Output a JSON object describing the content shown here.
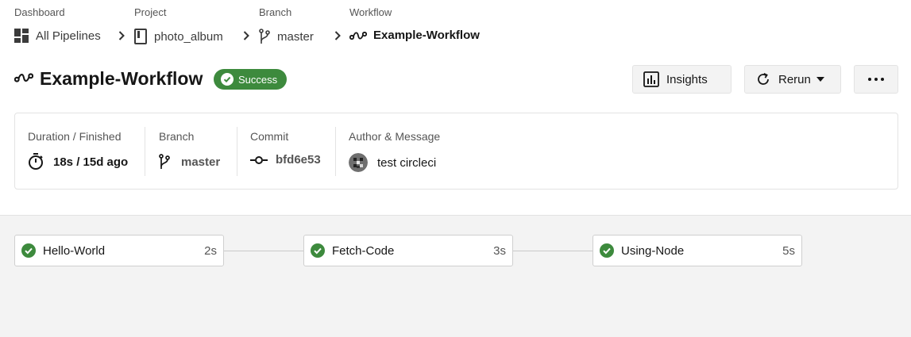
{
  "breadcrumb": {
    "dashboard": {
      "label": "Dashboard",
      "value": "All Pipelines",
      "icon": "dashboard-grid-icon"
    },
    "project": {
      "label": "Project",
      "value": "photo_album",
      "icon": "repo-icon"
    },
    "branch": {
      "label": "Branch",
      "value": "master",
      "icon": "git-branch-icon"
    },
    "workflow": {
      "label": "Workflow",
      "value": "Example-Workflow",
      "icon": "workflow-icon"
    }
  },
  "header": {
    "title": "Example-Workflow",
    "status": "Success",
    "status_color": "#3d8a3d",
    "insights_label": "Insights",
    "rerun_label": "Rerun"
  },
  "summary": {
    "duration": {
      "label": "Duration / Finished",
      "value": "18s / 15d ago"
    },
    "branch": {
      "label": "Branch",
      "value": "master"
    },
    "commit": {
      "label": "Commit",
      "value": "bfd6e53"
    },
    "author": {
      "label": "Author & Message",
      "value": "test circleci"
    }
  },
  "jobs": [
    {
      "name": "Hello-World",
      "duration": "2s",
      "status": "success"
    },
    {
      "name": "Fetch-Code",
      "duration": "3s",
      "status": "success"
    },
    {
      "name": "Using-Node",
      "duration": "5s",
      "status": "success"
    }
  ]
}
